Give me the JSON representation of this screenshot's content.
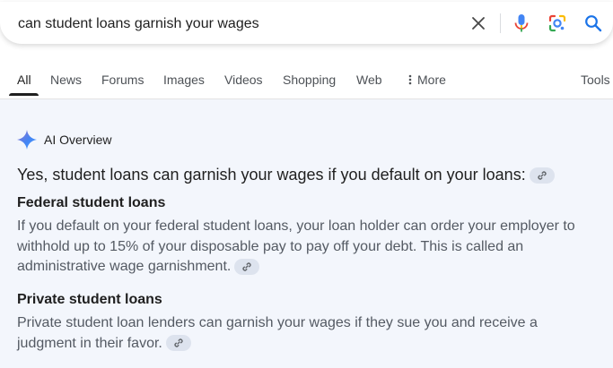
{
  "search": {
    "query": "can student loans garnish your wages"
  },
  "tabs": [
    {
      "label": "All"
    },
    {
      "label": "News"
    },
    {
      "label": "Forums"
    },
    {
      "label": "Images"
    },
    {
      "label": "Videos"
    },
    {
      "label": "Shopping"
    },
    {
      "label": "Web"
    },
    {
      "label": "More"
    }
  ],
  "tools_label": "Tools",
  "ai_overview": {
    "title": "AI Overview",
    "headline": "Yes, student loans can garnish your wages if you default on your loans:",
    "sections": [
      {
        "heading": "Federal student loans",
        "text": "If you default on your federal student loans, your loan holder can order your employer to withhold up to 15% of your disposable pay to pay off your debt. This is called an administrative wage garnishment."
      },
      {
        "heading": "Private student loans",
        "text": "Private student loan lenders can garnish your wages if they sue you and receive a judgment in their favor."
      }
    ]
  },
  "colors": {
    "mic_blue": "#4285f4",
    "mic_red": "#ea4335",
    "search_blue": "#1a73e8",
    "panel_bg": "#f3f6fc"
  },
  "icons": [
    "close-icon",
    "microphone-icon",
    "google-lens-icon",
    "search-icon",
    "more-dots-icon",
    "sparkle-icon",
    "link-icon"
  ]
}
